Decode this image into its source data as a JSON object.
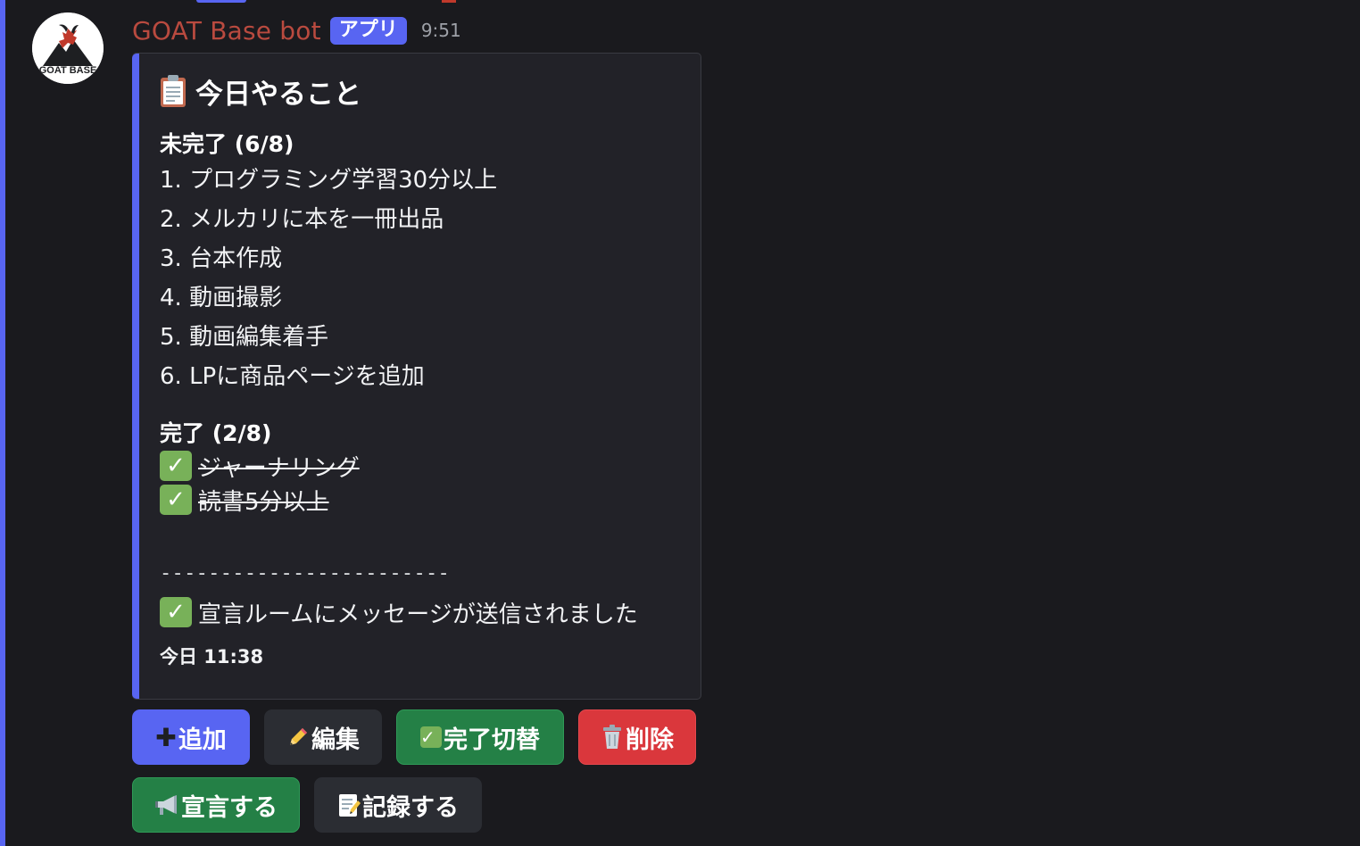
{
  "message": {
    "username": "GOAT Base bot",
    "app_badge": "アプリ",
    "timestamp": "9:51",
    "avatar_text": "GOAT BASE"
  },
  "embed": {
    "title": "今日やること",
    "title_icon": "clipboard-icon",
    "pending_header": "未完了 (6/8)",
    "pending_items": [
      "1. プログラミング学習30分以上",
      "2. メルカリに本を一冊出品",
      "3. 台本作成",
      "4. 動画撮影",
      "5. 動画編集着手",
      "6. LPに商品ページを追加"
    ],
    "done_header": "完了 (2/8)",
    "done_items": [
      "ジャーナリング",
      "読書5分以上"
    ],
    "separator": "------------------------",
    "announce_text": "宣言ルームにメッセージが送信されました",
    "footer_time": "今日 11:38",
    "accent_color": "#5865f2"
  },
  "buttons": {
    "add": {
      "label": "追加",
      "icon": "plus-icon"
    },
    "edit": {
      "label": "編集",
      "icon": "pencil-icon"
    },
    "toggle": {
      "label": "完了切替",
      "icon": "check-icon"
    },
    "delete": {
      "label": "削除",
      "icon": "trash-icon"
    },
    "declare": {
      "label": "宣言する",
      "icon": "megaphone-icon"
    },
    "record": {
      "label": "記録する",
      "icon": "memo-icon"
    }
  },
  "colors": {
    "username": "#b94a3f",
    "blurple": "#5865f2",
    "success": "#248046",
    "danger": "#da373c",
    "check": "#78b159"
  }
}
